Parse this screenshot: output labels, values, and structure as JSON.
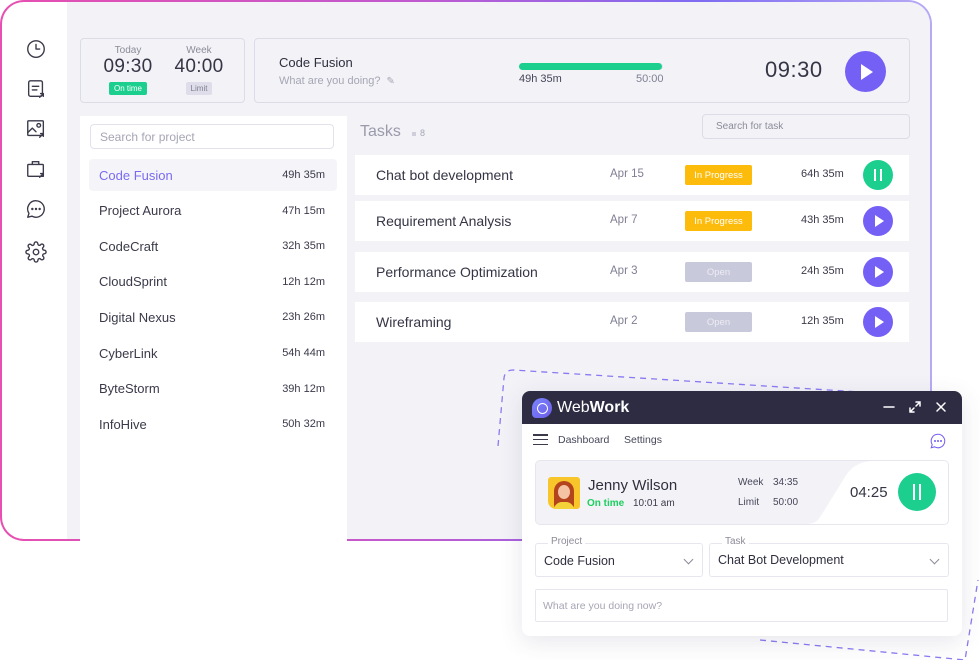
{
  "sidebar": {
    "icons": [
      {
        "name": "clock-icon"
      },
      {
        "name": "report-icon"
      },
      {
        "name": "image-report-icon"
      },
      {
        "name": "briefcase-icon"
      },
      {
        "name": "chat-icon"
      },
      {
        "name": "gear-icon"
      }
    ]
  },
  "summary": {
    "today_label": "Today",
    "today_value": "09:30",
    "today_badge": "On time",
    "week_label": "Week",
    "week_value": "40:00",
    "week_badge": "Limit"
  },
  "current": {
    "project": "Code Fusion",
    "placeholder": "What are you doing?",
    "progress_fraction": 0.99,
    "progress_tracked": "49h 35m",
    "progress_limit": "50:00",
    "timer": "09:30"
  },
  "projects": {
    "search_placeholder": "Search for project",
    "items": [
      {
        "name": "Code Fusion",
        "time": "49h 35m",
        "active": true
      },
      {
        "name": "Project Aurora",
        "time": "47h 15m"
      },
      {
        "name": "CodeCraft",
        "time": "32h 35m"
      },
      {
        "name": "CloudSprint",
        "time": "12h 12m"
      },
      {
        "name": "Digital Nexus",
        "time": "23h 26m"
      },
      {
        "name": "CyberLink",
        "time": "54h 44m"
      },
      {
        "name": "ByteStorm",
        "time": "39h 12m"
      },
      {
        "name": "InfoHive",
        "time": "50h 32m"
      }
    ]
  },
  "tasks": {
    "title": "Tasks",
    "count": "8",
    "search_placeholder": "Search for task",
    "items": [
      {
        "name": "Chat bot development",
        "date": "Apr 15",
        "status": "In Progress",
        "duration": "64h 35m",
        "action": "pause"
      },
      {
        "name": "Requirement Analysis",
        "date": "Apr 7",
        "status": "In Progress",
        "duration": "43h 35m",
        "action": "play"
      },
      {
        "name": "Performance Optimization",
        "date": "Apr 3",
        "status": "Open",
        "duration": "24h 35m",
        "action": "play"
      },
      {
        "name": "Wireframing",
        "date": "Apr 2",
        "status": "Open",
        "duration": "12h 35m",
        "action": "play"
      }
    ]
  },
  "widget": {
    "brand_light": "Web",
    "brand_bold": "Work",
    "nav": [
      "Dashboard",
      "Settings"
    ],
    "user": {
      "name": "Jenny Wilson",
      "status": "On time",
      "clock_in": "10:01 am",
      "week_label": "Week",
      "week_value": "34:35",
      "limit_label": "Limit",
      "limit_value": "50:00",
      "timer": "04:25"
    },
    "project_label": "Project",
    "project_value": "Code Fusion",
    "task_label": "Task",
    "task_value": "Chat Bot Development",
    "doing_placeholder": "What are you doing now?"
  },
  "colors": {
    "accent_purple": "#7560f5",
    "accent_green": "#1ccf8f",
    "in_progress": "#fdbb0c",
    "open": "#c9c9dc",
    "titlebar": "#2e2c43"
  }
}
